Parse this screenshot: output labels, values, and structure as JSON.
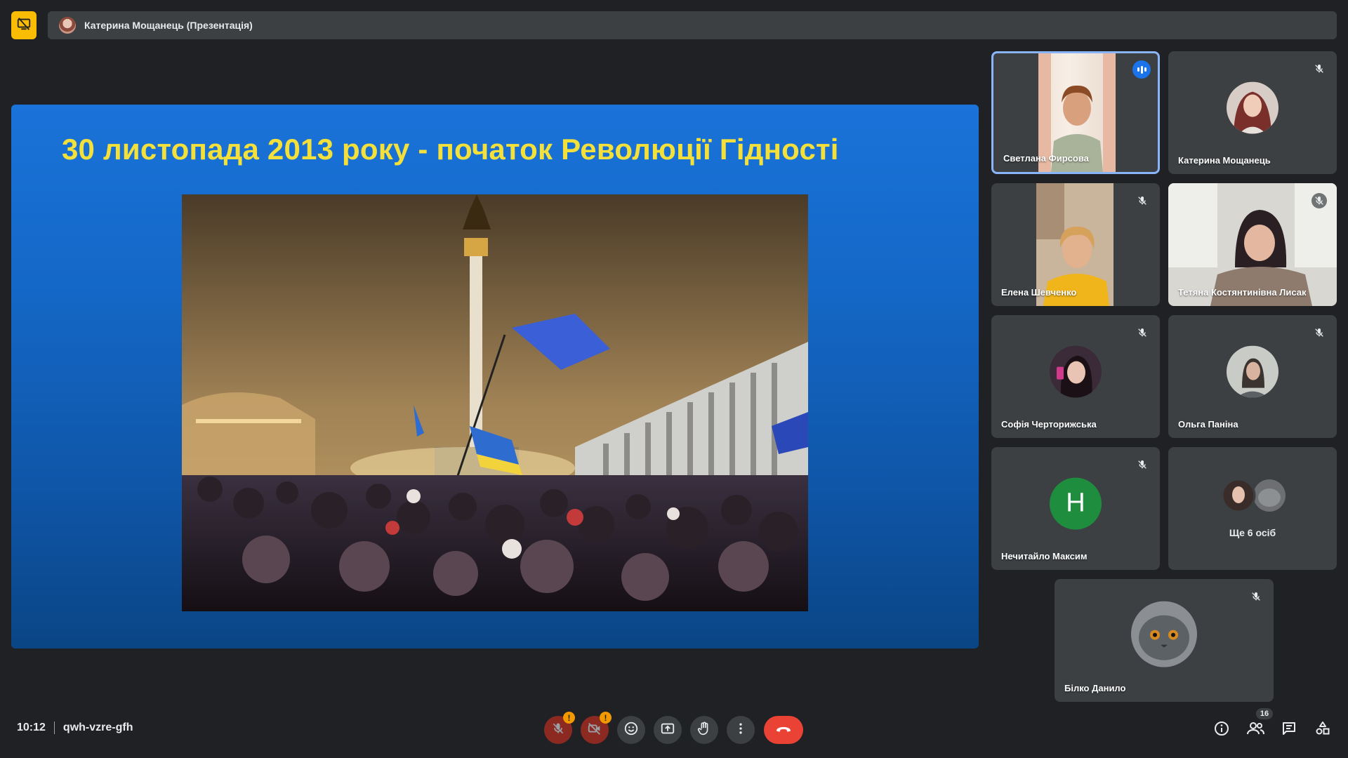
{
  "header": {
    "presenter_title": "Катерина Мощанець (Презентація)"
  },
  "slide": {
    "title": "30 листопада 2013 року - початок Революції Гідності"
  },
  "participants": [
    {
      "name": "Светлана Фирсова",
      "speaking": true,
      "muted": false
    },
    {
      "name": "Катерина Мощанець",
      "speaking": false,
      "muted": true
    },
    {
      "name": "Елена Шевченко",
      "speaking": false,
      "muted": true
    },
    {
      "name": "Тетяна Костянтинівна Лисак",
      "speaking": false,
      "muted": true
    },
    {
      "name": "Софія Черторижська",
      "speaking": false,
      "muted": true
    },
    {
      "name": "Ольга Паніна",
      "speaking": false,
      "muted": true
    },
    {
      "name": "Нечитайло Максим",
      "speaking": false,
      "muted": true,
      "avatar_letter": "H"
    },
    {
      "name": "Білко Данило",
      "speaking": false,
      "muted": true
    }
  ],
  "more_tile": {
    "label": "Ще 6 осіб"
  },
  "meeting": {
    "time": "10:12",
    "code": "qwh-vzre-gfh",
    "participants_count": "16"
  },
  "colors": {
    "background": "#202124",
    "panel": "#3c4043",
    "accent": "#8ab4f8",
    "end_call": "#ea4335",
    "warning": "#f29900",
    "slide_title": "#f4e03b"
  },
  "icons": {
    "presentation_badge": "present-off-icon",
    "mic": "mic-off-icon",
    "camera": "camera-off-icon",
    "emoji": "emoji-icon",
    "present": "present-screen-icon",
    "hand": "raise-hand-icon",
    "more": "more-vert-icon",
    "end": "call-end-icon",
    "info": "info-icon",
    "people": "people-icon",
    "chat": "chat-icon",
    "activities": "activities-icon"
  }
}
